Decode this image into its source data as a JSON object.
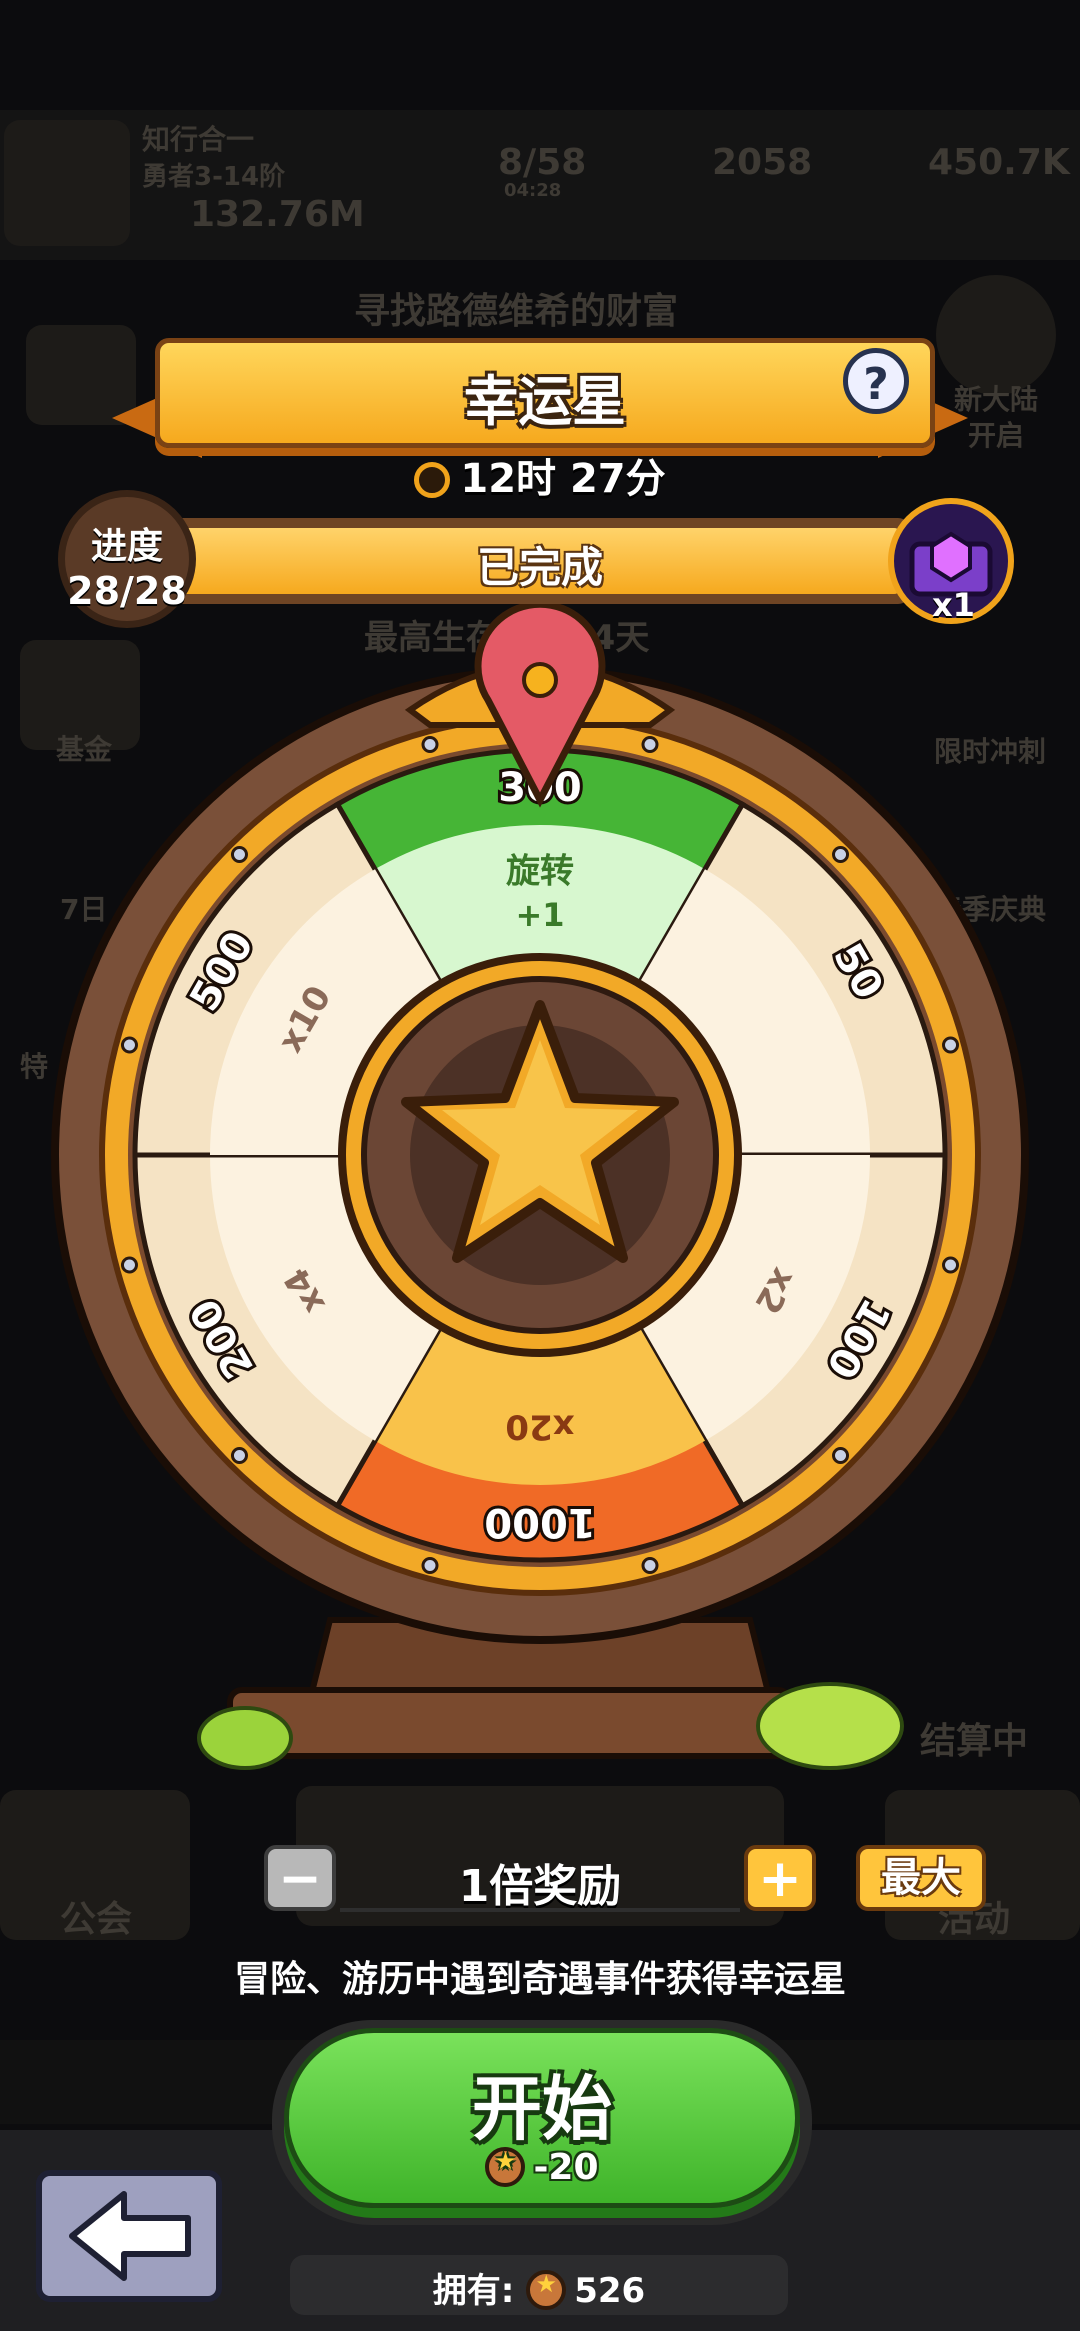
{
  "background": {
    "player_name": "知行合一",
    "player_rank": "勇者3-14阶",
    "power": "132.76M",
    "energy": "8/58",
    "energy_timer": "04:28",
    "gems": "2058",
    "gold": "450.7K",
    "quest_title": "寻找路德维希的财富",
    "left_items": [
      "基金",
      "7日",
      "特"
    ],
    "right_items": [
      "新大陆",
      "开启",
      "限时冲刺",
      "春季庆典",
      "结算中",
      "活动"
    ],
    "guild_label": "公会",
    "record_text": "最高生存天数24天"
  },
  "header": {
    "title": "幸运星",
    "help_icon": "question-icon",
    "timer": "12时 27分"
  },
  "progress": {
    "badge_title": "进度",
    "badge_value": "28/28",
    "status": "已完成",
    "fraction": 1.0,
    "chest_count": "x1"
  },
  "wheel": {
    "segments": [
      {
        "value": "300",
        "sub": "旋转",
        "sub2": "+1",
        "color": "#46b536"
      },
      {
        "value": "50",
        "sub": "",
        "sub2": "",
        "color": "#f5e3c4"
      },
      {
        "value": "100",
        "sub": "x2",
        "sub2": "",
        "color": "#f5e3c4"
      },
      {
        "value": "1000",
        "sub": "x20",
        "sub2": "",
        "color": "#f06a26"
      },
      {
        "value": "200",
        "sub": "x4",
        "sub2": "",
        "color": "#f5e3c4"
      },
      {
        "value": "500",
        "sub": "x10",
        "sub2": "",
        "color": "#f5e3c4"
      }
    ],
    "center_icon": "star-icon",
    "pointer_icon": "pin-pointer-icon"
  },
  "controls": {
    "minus": "−",
    "reward": "1倍奖励",
    "plus": "+",
    "max": "最大"
  },
  "hint": "冒险、游历中遇到奇遇事件获得幸运星",
  "start": {
    "label": "开始",
    "cost": "-20"
  },
  "owned": {
    "label": "拥有:",
    "value": "526"
  },
  "colors": {
    "accent_orange": "#f6a91e",
    "start_green": "#46b536",
    "wood": "#6f4524"
  }
}
